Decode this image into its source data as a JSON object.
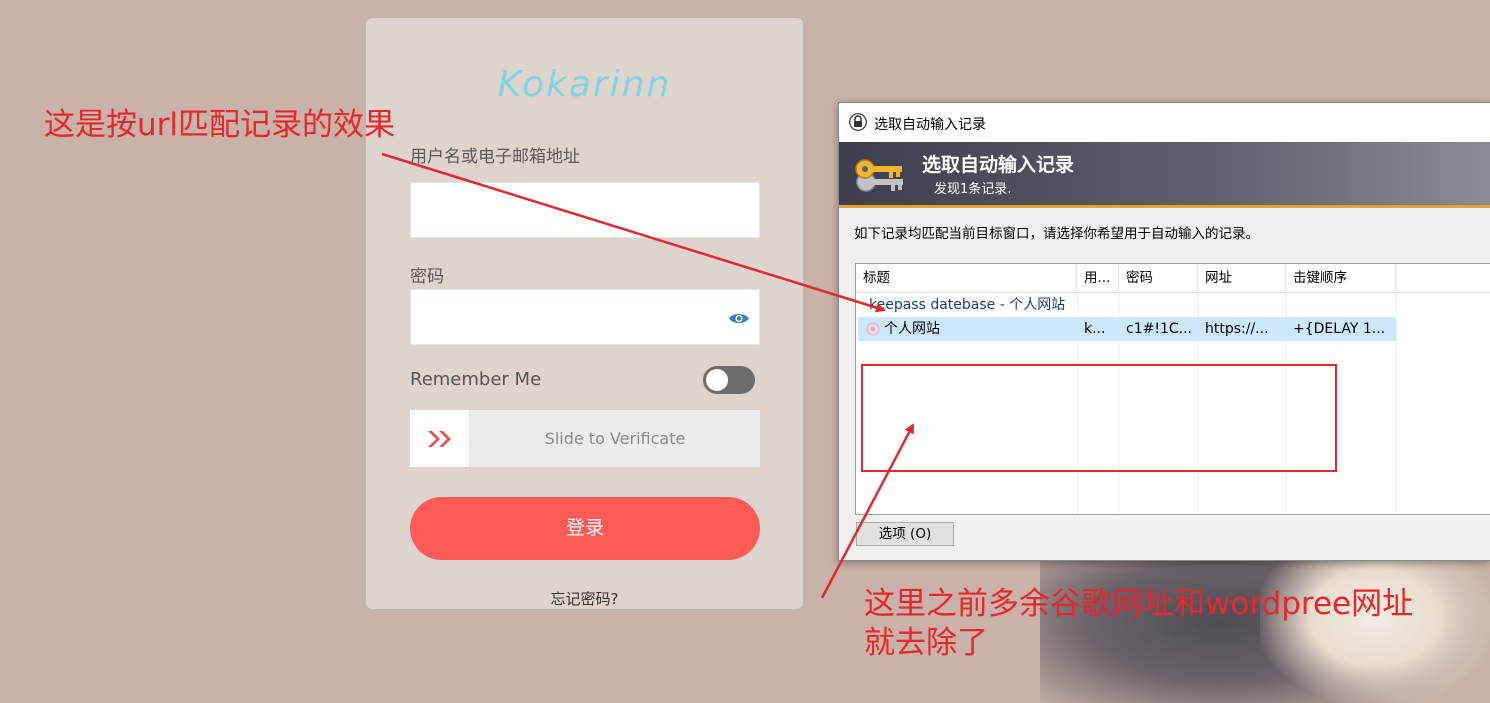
{
  "login": {
    "logo": "Kokarinn",
    "username_label": "用户名或电子邮箱地址",
    "password_label": "密码",
    "remember_label": "Remember Me",
    "slider_text": "Slide to Verificate",
    "login_button": "登录",
    "forgot_link": "忘记密码?"
  },
  "dialog": {
    "window_title": "选取自动输入记录",
    "banner_title": "选取自动输入记录",
    "banner_subtitle": "发现1条记录.",
    "description": "如下记录均匹配当前目标窗口，请选择你希望用于自动输入的记录。",
    "columns": [
      "标题",
      "用...",
      "密码",
      "网址",
      "击键顺序"
    ],
    "group_label": "keepass datebase - 个人网站",
    "row": {
      "title": "个人网站",
      "user": "k...",
      "password": "c1#!1C...",
      "url": "https://...",
      "sequence": "+{DELAY 1..."
    },
    "options_button": "选项 (O)"
  },
  "annotations": {
    "top": "这是按url匹配记录的效果",
    "bottom_line1": "这里之前多余谷歌网址和wordpree网址",
    "bottom_line2": "就去除了"
  },
  "colors": {
    "background": "#c9b3a8",
    "card": "#dfd3cd",
    "login_button": "#fe5b56",
    "annotation": "#e8262b",
    "selection": "#cce8ff",
    "banner_accent": "#f0a030"
  }
}
